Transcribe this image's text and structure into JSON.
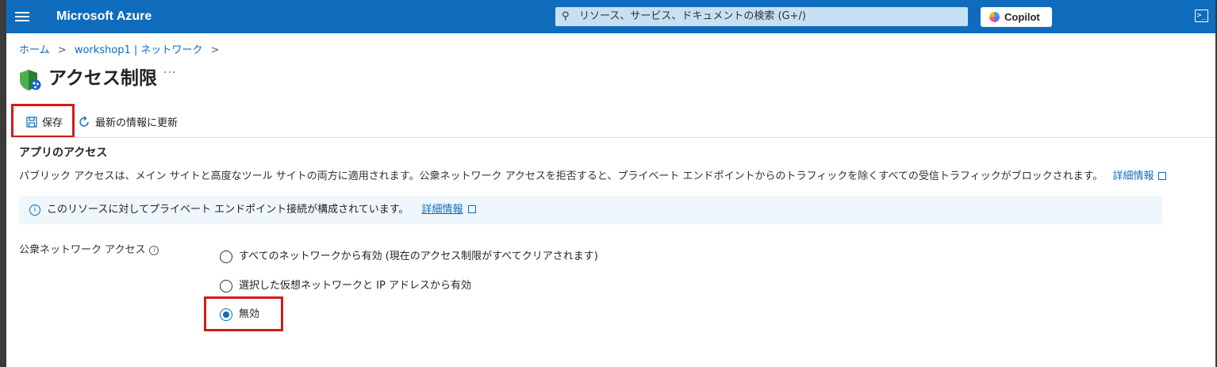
{
  "header": {
    "brand": "Microsoft Azure",
    "search_placeholder": "リソース、サービス、ドキュメントの検索 (G+/)",
    "copilot_label": "Copilot",
    "accent_color": "#0f6cbd"
  },
  "breadcrumb": {
    "items": [
      "ホーム",
      "workshop1 | ネットワーク"
    ]
  },
  "page": {
    "title": "アクセス制限",
    "more": "···"
  },
  "toolbar": {
    "save_label": "保存",
    "refresh_label": "最新の情報に更新"
  },
  "section": {
    "title": "アプリのアクセス",
    "description": "パブリック アクセスは、メイン サイトと高度なツール サイトの両方に適用されます。公衆ネットワーク アクセスを拒否すると、プライベート エンドポイントからのトラフィックを除くすべての受信トラフィックがブロックされます。",
    "learn_more": "詳細情報"
  },
  "info_banner": {
    "text": "このリソースに対してプライベート エンドポイント接続が構成されています。",
    "link": "詳細情報"
  },
  "public_network_access": {
    "label": "公衆ネットワーク アクセス",
    "options": [
      {
        "label": "すべてのネットワークから有効 (現在のアクセス制限がすべてクリアされます)",
        "selected": false
      },
      {
        "label": "選択した仮想ネットワークと IP アドレスから有効",
        "selected": false
      },
      {
        "label": "無効",
        "selected": true
      }
    ]
  }
}
